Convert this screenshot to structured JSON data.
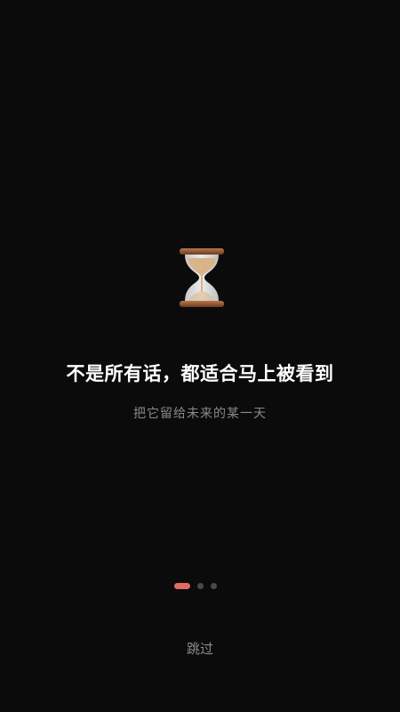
{
  "onboarding": {
    "icon": "hourglass-icon",
    "headline": "不是所有话，都适合马上被看到",
    "subline": "把它留给未来的某一天",
    "pager": {
      "total": 3,
      "active_index": 0,
      "active_color": "#e06a64",
      "inactive_color": "#4a4a4a"
    },
    "skip_label": "跳过"
  },
  "theme": {
    "background": "#0b0b0b",
    "headline_color": "#ffffff",
    "subline_color": "#8a8a8a"
  }
}
